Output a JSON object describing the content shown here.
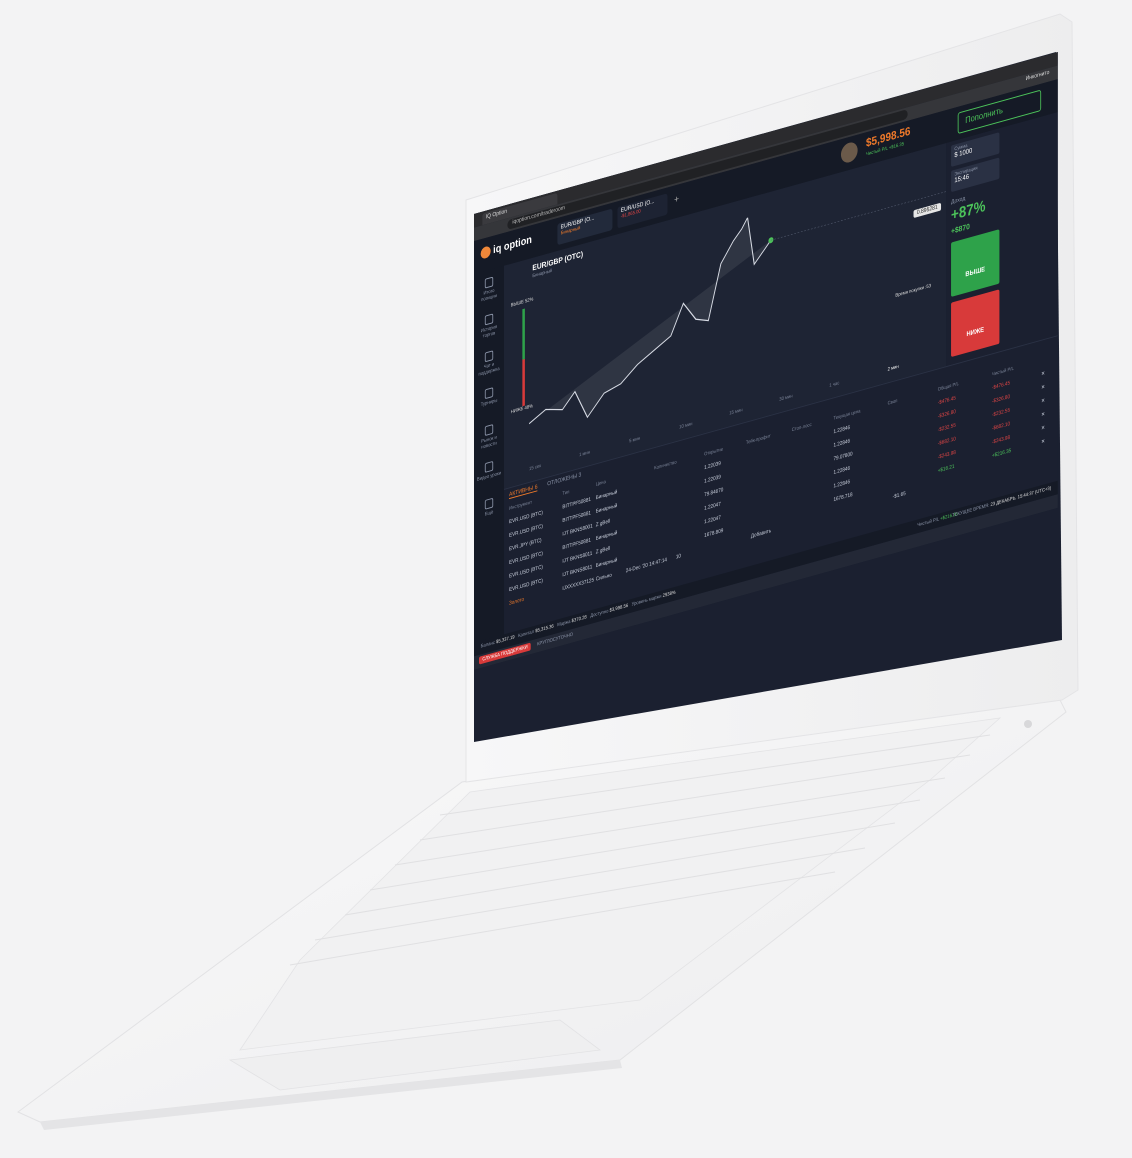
{
  "browser": {
    "tab_title": "IQ Option",
    "url": "iqoption.com/traderoom",
    "incognito_label": "Инкогнито"
  },
  "header": {
    "logo_text": "iq option",
    "asset_tab_1": {
      "name": "EUR/GBP (O...",
      "sub": "Бинарный"
    },
    "asset_tab_2": {
      "name": "EUR/USD (O...",
      "sub": "-$1,865.00"
    },
    "balance": "$5,998.56",
    "balance_sub": "Чистый P/L +$16.35",
    "deposit_label": "Пополнить"
  },
  "sidebar": {
    "items": [
      {
        "label": "Итого позиции"
      },
      {
        "label": "История торгов"
      },
      {
        "label": "Чат и поддержка"
      },
      {
        "label": "Турниры"
      },
      {
        "label": "Рынок и новости"
      },
      {
        "label": "Видео уроки"
      },
      {
        "label": "Ещё"
      }
    ],
    "higher_label": "ВЫШЕ",
    "higher_pct": "52%",
    "lower_label": "НИЖЕ",
    "lower_pct": "48%"
  },
  "chart": {
    "asset_title": "EUR/GBP (OTC)",
    "asset_sub": "Бинарный",
    "current_price": "0.895281",
    "time_labels": [
      "15 сек",
      "1 мин",
      "5 мин",
      "10 мин",
      "15 мин",
      "30 мин",
      "1 час",
      "2 мин"
    ],
    "timer_label": "Время покупки",
    "timer_value": ":53"
  },
  "right_panel": {
    "amount_label": "Сумма",
    "amount_value": "$ 1000",
    "expiry_label": "Экспирация",
    "expiry_value": "15:46",
    "income_label": "Доход",
    "income_pct": "+87%",
    "income_amount": "+$870",
    "up_label": "ВЫШЕ",
    "down_label": "НИЖЕ"
  },
  "positions": {
    "tabs": [
      "АКТИВНЫ 6",
      "ОТЛОЖЕНЫ 3"
    ],
    "columns": [
      "Инструмент",
      "Тип",
      "Цена",
      "Количество",
      "Открытие",
      "Тейк-профит",
      "Стоп-лосс",
      "Текущая цена",
      "Своп",
      "Общая P/L",
      "Чистый P/L"
    ],
    "rows": [
      {
        "asset": "EVR.USD (BTC)",
        "id": "BITTPF50881",
        "type": "Бинарный",
        "open": "1.22039",
        "current": "1.22846",
        "total": "-$476.45",
        "net": "-$476.45"
      },
      {
        "asset": "EVR.USD (BTC)",
        "id": "BITTPF50881",
        "type": "Бинарный",
        "open": "1.22039",
        "current": "1.22846",
        "total": "-$326.80",
        "net": "-$326.80"
      },
      {
        "asset": "EVR.JPY (BTC)",
        "id": "IJT BKNS8001",
        "type": "Z gBell",
        "open": "79.84670",
        "current": "79.07800",
        "total": "-$232.55",
        "net": "-$232.55"
      },
      {
        "asset": "EVR.USD (BTC)",
        "id": "BITTPF50881",
        "type": "Бинарный",
        "open": "1.22047",
        "current": "1.22846",
        "total": "-$682.10",
        "net": "-$682.10"
      },
      {
        "asset": "EVR.USD (BTC)",
        "id": "IJT BKNS8011",
        "type": "Z gBell",
        "open": "1.22047",
        "current": "1.22846",
        "total": "-$243.98",
        "net": "-$243.98"
      },
      {
        "asset": "EVR.USD (BTC)",
        "id": "IJT BKNS8011",
        "type": "Бинарный",
        "open": "1678.809",
        "current": "1678.718",
        "total": "+$16.21",
        "net": "+$216.35"
      }
    ],
    "gold_row": {
      "asset": "Золото",
      "id": "IJXXXXX37125",
      "type": "Сильно",
      "date": "24-Dec '20 14:47:14",
      "qty": "10",
      "swap": "-$1.65"
    },
    "add_label": "Добавить"
  },
  "status": {
    "net_pl_label": "Чистый P/L",
    "net_pl_value": "+$216.35",
    "current_time_label": "ТЕКУЩЕЕ ВРЕМЯ:",
    "current_time_value": "23 ДЕКАБРЬ, 15:44:37 (UTC+3)",
    "balance_label": "Баланс",
    "balance_value": "$5,337.19",
    "equity_label": "Капитал",
    "equity_value": "$5,315.36",
    "margin_label": "Маржа",
    "margin_value": "$370.28",
    "available_label": "Доступно",
    "available_value": "$3,998.56",
    "margin_level_label": "Уровень маржи",
    "margin_level_value": "2938%"
  },
  "support": {
    "button_label": "СЛУЖБА ПОДДЕРЖКИ",
    "text": "КРУГЛОСУТОЧНО"
  },
  "colors": {
    "app_bg": "#1b2030",
    "accent_orange": "#f07a2a",
    "up_green": "#2ea24a",
    "down_red": "#d83a3a",
    "background": "#f3f3f4"
  }
}
